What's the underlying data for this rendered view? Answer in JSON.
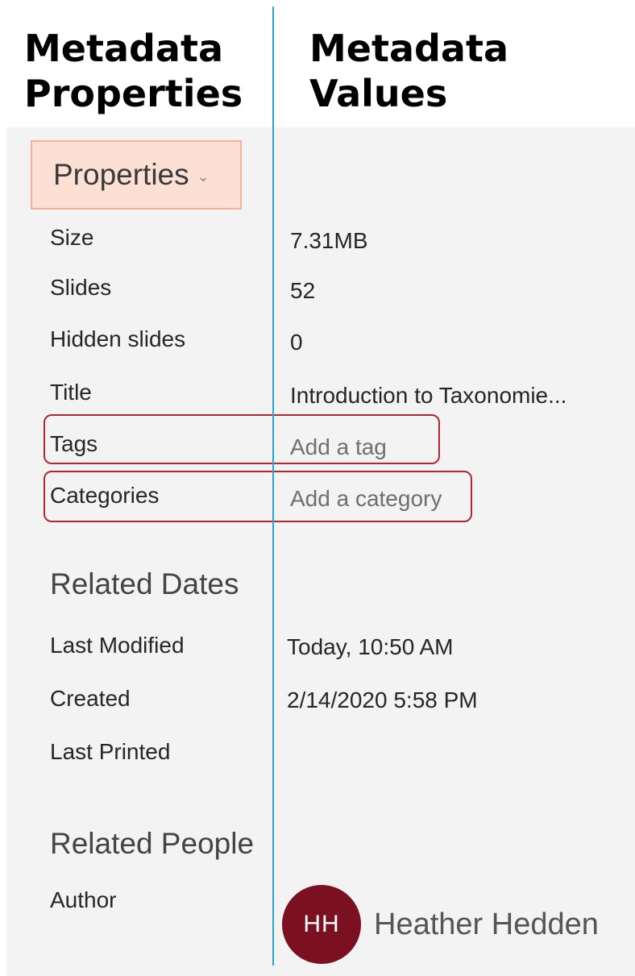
{
  "headers": {
    "left": [
      "Metadata",
      "Properties"
    ],
    "right": [
      "Metadata",
      "Values"
    ]
  },
  "properties_button": {
    "label": "Properties",
    "icon": "chevron-down-icon"
  },
  "properties": [
    {
      "label": "Size",
      "value": "7.31MB"
    },
    {
      "label": "Slides",
      "value": "52"
    },
    {
      "label": "Hidden slides",
      "value": "0"
    },
    {
      "label": "Title",
      "value": "Introduction to Taxonomie..."
    },
    {
      "label": "Tags",
      "value": "Add a tag"
    },
    {
      "label": "Categories",
      "value": "Add a category"
    }
  ],
  "related_dates": {
    "heading": "Related Dates",
    "items": [
      {
        "label": "Last Modified",
        "value": "Today, 10:50 AM"
      },
      {
        "label": "Created",
        "value": "2/14/2020 5:58 PM"
      },
      {
        "label": "Last Printed",
        "value": ""
      }
    ]
  },
  "related_people": {
    "heading": "Related People",
    "author_label": "Author",
    "author_initials": "HH",
    "author_name": "Heather Hedden"
  },
  "colors": {
    "divider": "#2aa7c6",
    "highlight_box": "#b52630",
    "avatar": "#7a1020",
    "properties_button_bg": "#fbe0d3"
  }
}
